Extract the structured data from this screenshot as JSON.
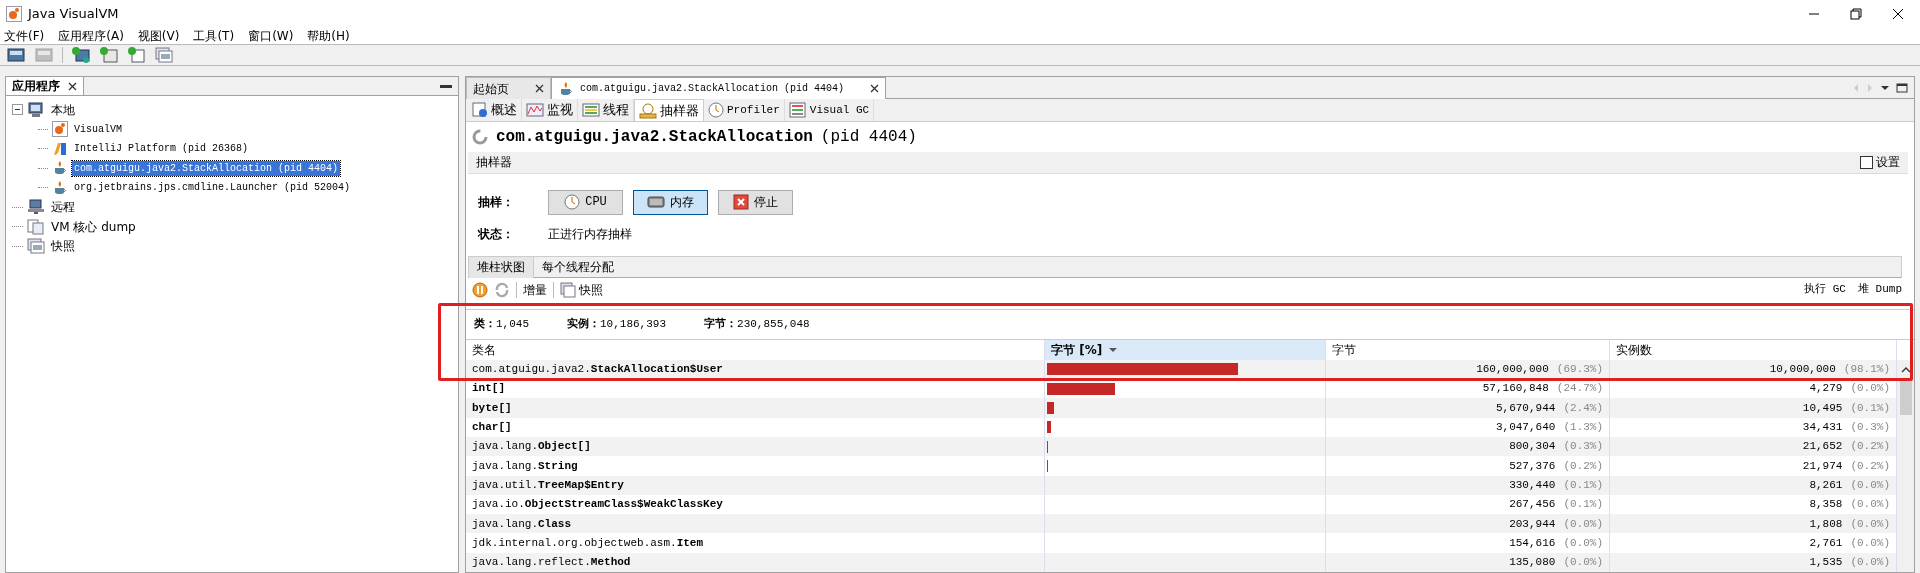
{
  "window": {
    "title": "Java VisualVM"
  },
  "menu": [
    "文件(F)",
    "应用程序(A)",
    "视图(V)",
    "工具(T)",
    "窗口(W)",
    "帮助(H)"
  ],
  "toolbar": [
    {
      "kind": "open",
      "disabled": false
    },
    {
      "kind": "save",
      "disabled": true
    },
    {
      "kind": "host",
      "disabled": false
    },
    {
      "kind": "jmx",
      "disabled": false
    },
    {
      "kind": "dump",
      "disabled": false
    },
    {
      "kind": "snapshot",
      "disabled": false
    }
  ],
  "left_panel": {
    "title": "应用程序",
    "tree": [
      {
        "label": "本地",
        "kind": "computer",
        "selected": false,
        "expanded": true,
        "children": [
          {
            "label": "VisualVM",
            "kind": "visualvm",
            "selected": false
          },
          {
            "label": "IntelliJ Platform (pid 26368)",
            "kind": "intellij",
            "selected": false
          },
          {
            "label": "com.atguigu.java2.StackAllocation (pid 4404)",
            "kind": "java",
            "selected": true
          },
          {
            "label": "org.jetbrains.jps.cmdline.Launcher (pid 52004)",
            "kind": "java",
            "selected": false
          }
        ]
      },
      {
        "label": "远程",
        "kind": "remote",
        "selected": false
      },
      {
        "label": "VM 核心 dump",
        "kind": "coredump",
        "selected": false
      },
      {
        "label": "快照",
        "kind": "snapshot",
        "selected": false
      }
    ]
  },
  "doc_tabs": [
    {
      "label": "起始页",
      "selected": false,
      "kind": "start"
    },
    {
      "label": "com.atguigu.java2.StackAllocation (pid 4404)",
      "selected": true,
      "kind": "java"
    }
  ],
  "view_tabs": [
    {
      "label": "概述",
      "kind": "info",
      "selected": false
    },
    {
      "label": "监视",
      "kind": "monitor",
      "selected": false
    },
    {
      "label": "线程",
      "kind": "threads",
      "selected": false
    },
    {
      "label": "抽样器",
      "kind": "sampler",
      "selected": true
    },
    {
      "label": "Profiler",
      "kind": "profiler",
      "selected": false
    },
    {
      "label": "Visual GC",
      "kind": "gc",
      "selected": false
    }
  ],
  "app_title": {
    "name": "com.atguigu.java2.StackAllocation",
    "pid": "(pid 4404)"
  },
  "sampler": {
    "header": "抽样器",
    "settings": {
      "label": "设置",
      "checked": false
    },
    "sample_label": "抽样：",
    "buttons": [
      {
        "label": "CPU",
        "kind": "cpu",
        "selected": false
      },
      {
        "label": "内存",
        "kind": "memory",
        "selected": true
      },
      {
        "label": "停止",
        "kind": "stop",
        "selected": false
      }
    ],
    "status_label": "状态：",
    "status": "正进行内存抽样"
  },
  "result_tabs": [
    {
      "label": "堆柱状图",
      "selected": true
    },
    {
      "label": "每个线程分配",
      "selected": false
    }
  ],
  "result_toolbar": {
    "left": [
      {
        "label": "增量",
        "kind": "delta"
      },
      {
        "label": "快照",
        "kind": "snapshot"
      }
    ],
    "right": [
      "执行 GC",
      "堆 Dump"
    ]
  },
  "summary": [
    {
      "label": "类：",
      "value": "1,045"
    },
    {
      "label": "实例：",
      "value": "10,186,393"
    },
    {
      "label": "字节：",
      "value": "230,855,048"
    }
  ],
  "table": {
    "columns": [
      {
        "label": "类名",
        "sorted": false
      },
      {
        "label": "字节 [%]",
        "sorted": true
      },
      {
        "label": "字节",
        "sorted": false
      },
      {
        "label": "实例数",
        "sorted": false
      }
    ],
    "rows": [
      {
        "package": "com.atguigu.java2.",
        "class_name": "StackAllocation$User",
        "level": 0.693,
        "bytes": "160,000,000",
        "bytes_pct": "(69.3%)",
        "instances": "10,000,000",
        "instances_pct": "(98.1%)"
      },
      {
        "class_name": "int[]",
        "level": 0.247,
        "bytes": "57,160,848",
        "bytes_pct": "(24.7%)",
        "instances": "4,279",
        "instances_pct": "(0.0%)"
      },
      {
        "class_name": "byte[]",
        "level": 0.024,
        "bytes": "5,670,944",
        "bytes_pct": "(2.4%)",
        "instances": "10,495",
        "instances_pct": "(0.1%)"
      },
      {
        "class_name": "char[]",
        "level": 0.013,
        "bytes": "3,047,640",
        "bytes_pct": "(1.3%)",
        "instances": "34,431",
        "instances_pct": "(0.3%)"
      },
      {
        "package": "java.lang.",
        "class_name": "Object[]",
        "level": 0.003,
        "bytes": "800,304",
        "bytes_pct": "(0.3%)",
        "instances": "21,652",
        "instances_pct": "(0.2%)"
      },
      {
        "package": "java.lang.",
        "class_name": "String",
        "level": 0.002,
        "bytes": "527,376",
        "bytes_pct": "(0.2%)",
        "instances": "21,974",
        "instances_pct": "(0.2%)"
      },
      {
        "package": "java.util.",
        "class_name": "TreeMap$Entry",
        "bytes": "330,440",
        "bytes_pct": "(0.1%)",
        "instances": "8,261",
        "instances_pct": "(0.0%)"
      },
      {
        "package": "java.io.",
        "class_name": "ObjectStreamClass$WeakClassKey",
        "bytes": "267,456",
        "bytes_pct": "(0.1%)",
        "instances": "8,358",
        "instances_pct": "(0.0%)"
      },
      {
        "package": "java.lang.",
        "class_name": "Class",
        "bytes": "203,944",
        "bytes_pct": "(0.0%)",
        "instances": "1,808",
        "instances_pct": "(0.0%)"
      },
      {
        "package": "jdk.internal.org.objectweb.asm.",
        "class_name": "Item",
        "bytes": "154,616",
        "bytes_pct": "(0.0%)",
        "instances": "2,761",
        "instances_pct": "(0.0%)"
      },
      {
        "package": "java.lang.reflect.",
        "class_name": "Method",
        "bytes": "135,080",
        "bytes_pct": "(0.0%)",
        "instances": "1,535",
        "instances_pct": "(0.0%)"
      }
    ]
  }
}
